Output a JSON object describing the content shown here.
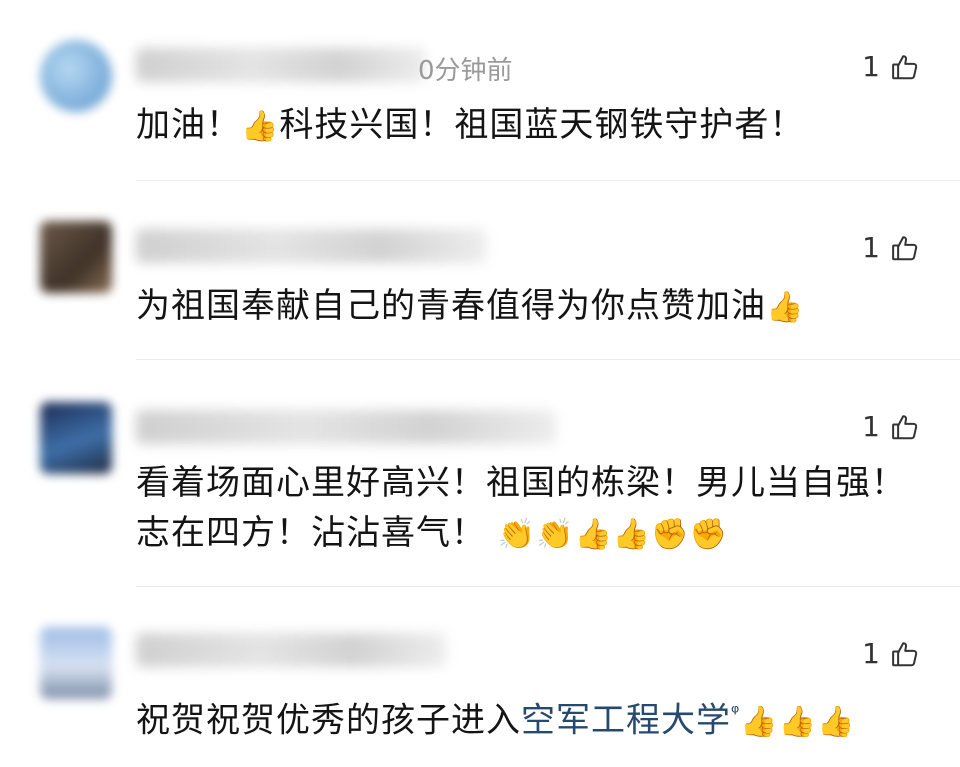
{
  "comments": [
    {
      "time": "0分钟前",
      "likes": "1",
      "text_before": "加油！",
      "emoji_1": "👍",
      "text_after": "科技兴国！祖国蓝天钢铁守护者！"
    },
    {
      "likes": "1",
      "text": "为祖国奉献自己的青春值得为你点赞加油",
      "emoji": "👍"
    },
    {
      "likes": "1",
      "line1": "看着场面心里好高兴！祖国的栋梁！男儿当自强！",
      "line2": "志在四方！沾沾喜气！",
      "emojis": "👏👏👍👍✊✊"
    },
    {
      "likes": "1",
      "text": "祝贺祝贺优秀的孩子进入",
      "link_text": "空军工程大学",
      "search_glyph": "ᵠ",
      "emojis": "👍👍👍"
    }
  ],
  "icons": {
    "like": "thumbs-up-outline-icon"
  },
  "colors": {
    "link": "#27496d",
    "muted": "#9a9a9a",
    "divider": "#ececec"
  }
}
